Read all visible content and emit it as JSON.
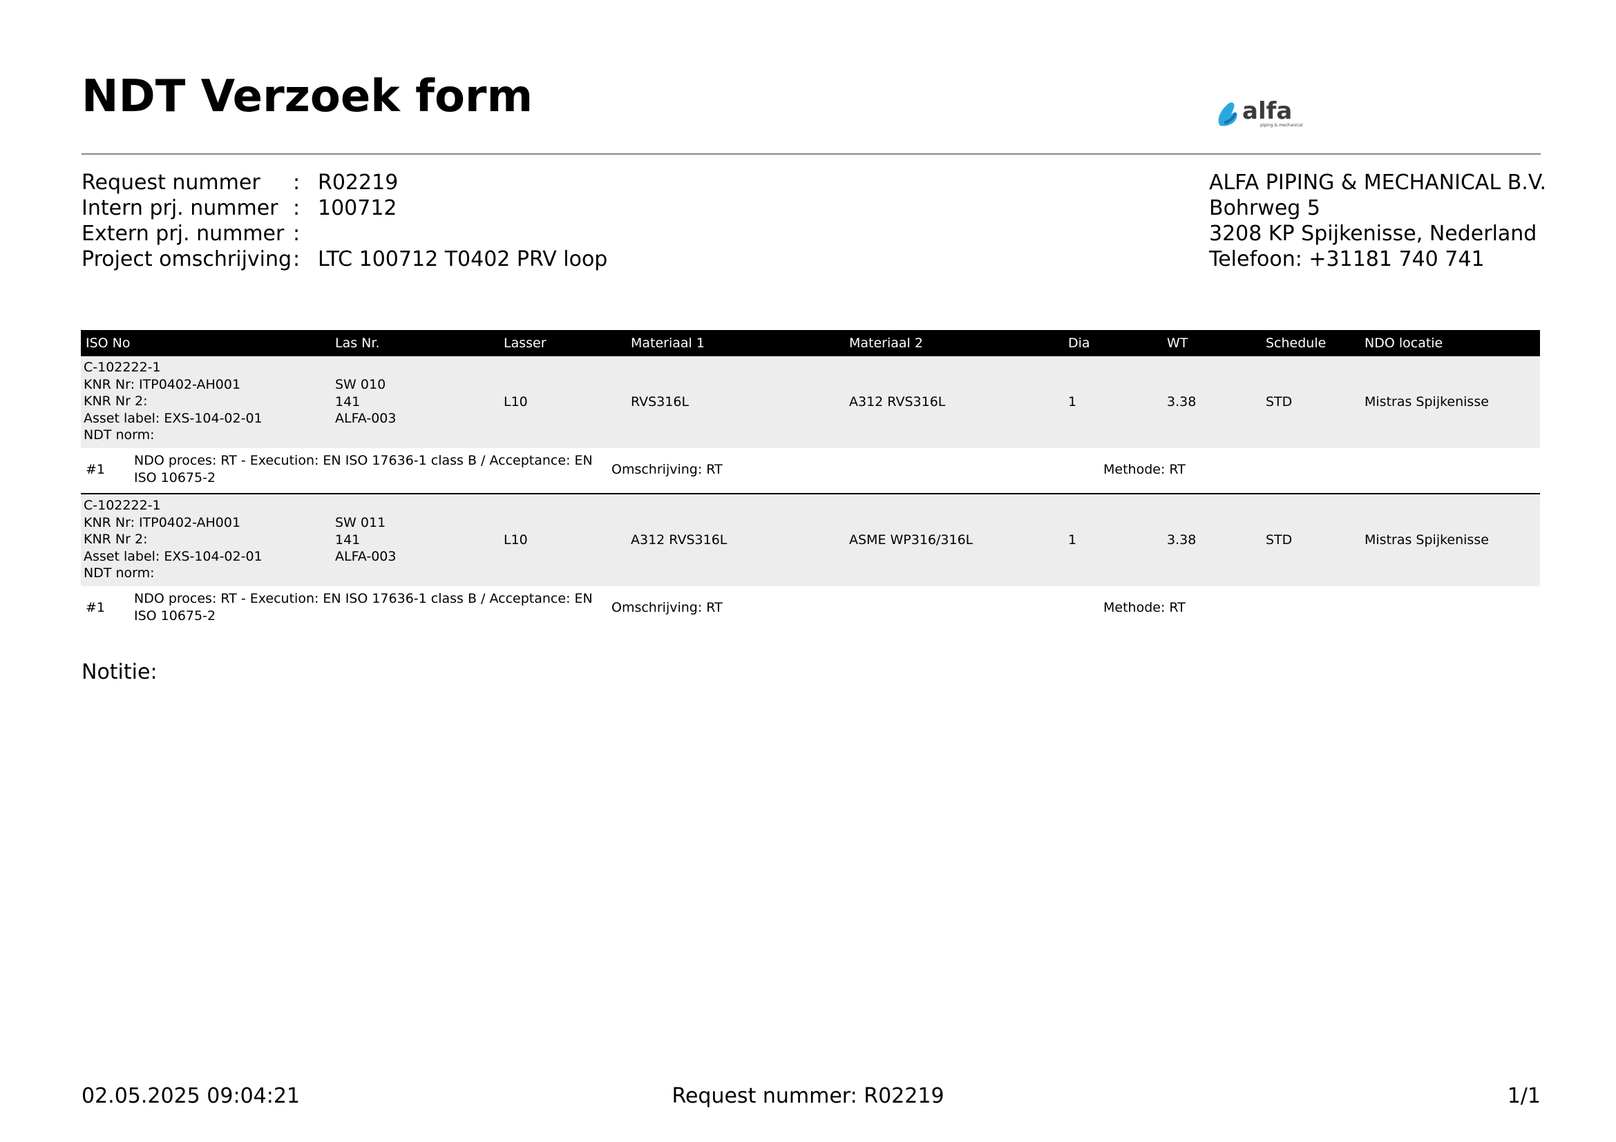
{
  "title": "NDT Verzoek form",
  "logo": {
    "text": "alfa",
    "tagline": "piping & mechanical",
    "colors": {
      "blue": "#29a8e0",
      "dark": "#3c3c3c"
    }
  },
  "meta": {
    "request": {
      "label": "Request nummer",
      "value": "R02219"
    },
    "intern": {
      "label": "Intern prj. nummer",
      "value": "100712"
    },
    "extern": {
      "label": "Extern prj. nummer",
      "value": ""
    },
    "project": {
      "label": "Project omschrijving",
      "value": "LTC 100712 T0402 PRV loop"
    },
    "colon": ":"
  },
  "company": {
    "name": "ALFA PIPING & MECHANICAL B.V.",
    "street": "Bohrweg 5",
    "city": "3208 KP Spijkenisse, Nederland",
    "phone": "Telefoon: +31181 740 741"
  },
  "table": {
    "headers": [
      "ISO No",
      "Las Nr.",
      "Lasser",
      "Materiaal 1",
      "Materiaal 2",
      "Dia",
      "WT",
      "Schedule",
      "NDO locatie"
    ],
    "rows": [
      {
        "iso": [
          "C-102222-1",
          "KNR Nr: ITP0402-AH001",
          "KNR Nr 2:",
          "Asset label: EXS-104-02-01",
          "NDT norm:"
        ],
        "las": [
          "SW 010",
          "141",
          "ALFA-003"
        ],
        "lasser": "L10",
        "mat1": "RVS316L",
        "mat2": "A312 RVS316L",
        "dia": "1",
        "wt": "3.38",
        "schedule": "STD",
        "locatie": "Mistras Spijkenisse",
        "sub": {
          "num": "#1",
          "proces_line1": "NDO proces: RT - Execution: EN ISO 17636-1 class B / Acceptance: EN",
          "proces_line2": "ISO 10675-2",
          "omschrijving": "Omschrijving: RT",
          "methode": "Methode: RT"
        }
      },
      {
        "iso": [
          "C-102222-1",
          "KNR Nr: ITP0402-AH001",
          "KNR Nr 2:",
          "Asset label: EXS-104-02-01",
          "NDT norm:"
        ],
        "las": [
          "SW 011",
          "141",
          "ALFA-003"
        ],
        "lasser": "L10",
        "mat1": "A312 RVS316L",
        "mat2": "ASME WP316/316L",
        "dia": "1",
        "wt": "3.38",
        "schedule": "STD",
        "locatie": "Mistras Spijkenisse",
        "sub": {
          "num": "#1",
          "proces_line1": "NDO proces: RT - Execution: EN ISO 17636-1 class B / Acceptance: EN",
          "proces_line2": "ISO 10675-2",
          "omschrijving": "Omschrijving: RT",
          "methode": "Methode: RT"
        }
      }
    ]
  },
  "notitie": "Notitie:",
  "footer": {
    "datetime": "02.05.2025 09:04:21",
    "request": "Request nummer: R02219",
    "page": "1/1"
  }
}
